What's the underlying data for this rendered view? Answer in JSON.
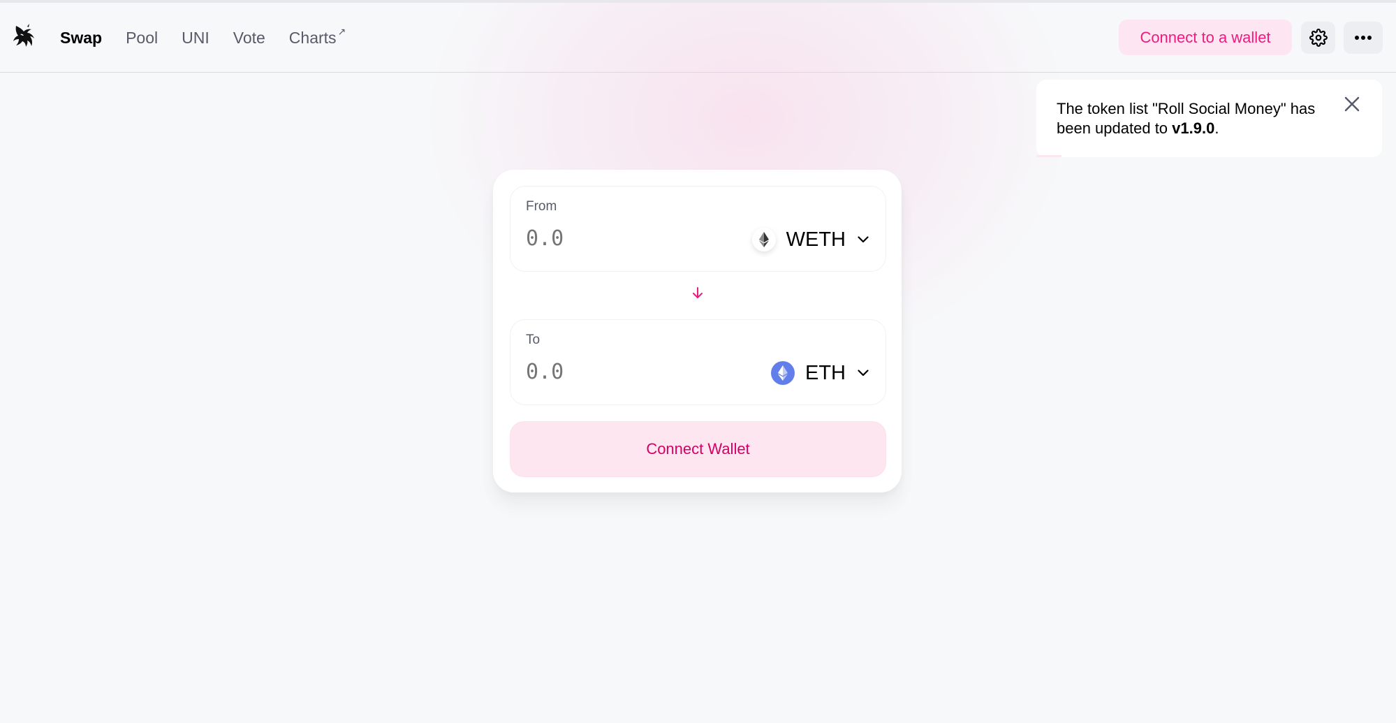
{
  "nav": {
    "items": [
      {
        "label": "Swap",
        "active": true
      },
      {
        "label": "Pool",
        "active": false
      },
      {
        "label": "UNI",
        "active": false
      },
      {
        "label": "Vote",
        "active": false
      },
      {
        "label": "Charts",
        "active": false,
        "external_arrow": "↗"
      }
    ]
  },
  "header": {
    "connect_label": "Connect to a wallet",
    "settings_icon": "gear-icon",
    "more_icon": "more-horizontal-icon"
  },
  "toast": {
    "text_before": "The token list \"Roll Social Money\" has been updated to ",
    "version": "v1.9.0",
    "text_after": "."
  },
  "swap": {
    "from": {
      "label": "From",
      "placeholder": "0.0",
      "token": "WETH"
    },
    "to": {
      "label": "To",
      "placeholder": "0.0",
      "token": "ETH"
    },
    "button_label": "Connect Wallet"
  },
  "colors": {
    "accent": "#ee1a7f",
    "accent_bg": "#fde6ef",
    "eth_blue": "#627eea"
  }
}
